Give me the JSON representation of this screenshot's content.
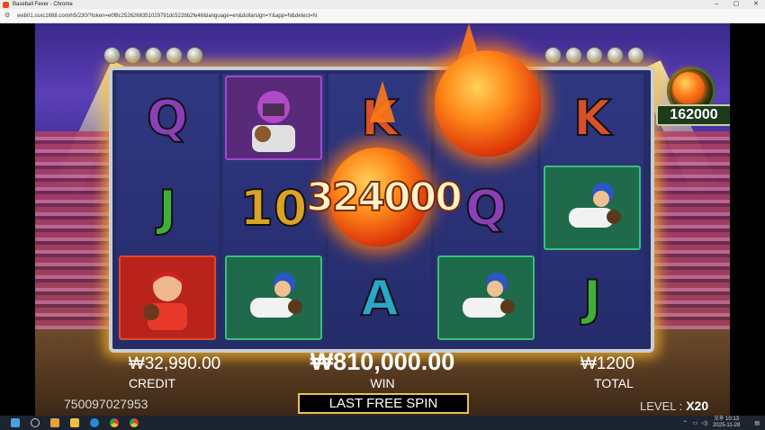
{
  "window": {
    "title": "Baseball Fever - Chrome",
    "controls": [
      "–",
      "▢",
      "✕"
    ]
  },
  "address_bar": {
    "url": "web01.ssxc1688.com/h5/230/?token=e0f8c2526268351029791dc522bb2fe48&language=en&dollarsign=Y&app=N&detect=N"
  },
  "game": {
    "title": "Baseball Fever",
    "reels": [
      [
        "Q",
        "J",
        "catcher-red"
      ],
      [
        "catcher-purple",
        "10",
        "player-green"
      ],
      [
        "K",
        "fireball",
        "A"
      ],
      [
        "fireball",
        "Q",
        "player-green"
      ],
      [
        "K",
        "player-green",
        "J"
      ]
    ],
    "big_win": "324000",
    "multiplier_value": "162000",
    "credit": {
      "amount": "₩32,990.00",
      "label": "CREDIT"
    },
    "win": {
      "amount": "₩810,000.00",
      "label": "WIN"
    },
    "total": {
      "amount": "₩1200",
      "label": "TOTAL"
    },
    "free_spin_button": "LAST FREE SPIN",
    "session_id": "750097027953",
    "level": {
      "label": "LEVEL :",
      "value": "X20"
    },
    "colors": {
      "Q": "#8a3fb8",
      "K": "#d8512a",
      "J": "#3fae3a",
      "10": "#d9a426",
      "A": "#2aa6c8"
    }
  },
  "taskbar": {
    "tray_time": "오후 10:13",
    "tray_date": "2025-11-28",
    "icons": [
      "windows-start-icon",
      "search-icon",
      "widgets-icon",
      "file-explorer-icon",
      "edge-icon",
      "chrome-icon",
      "chrome-icon"
    ]
  }
}
